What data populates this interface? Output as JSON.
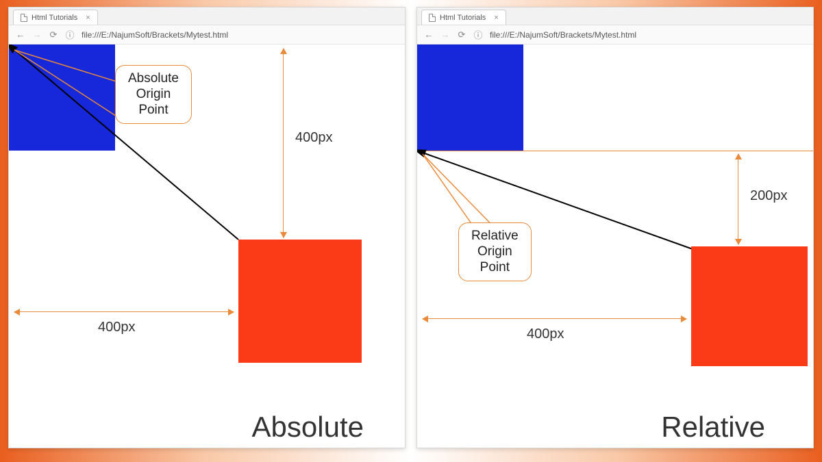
{
  "browser": {
    "tab_title": "Html Tutorials",
    "url": "file:///E:/NajumSoft/Brackets/Mytest.html"
  },
  "left_panel": {
    "callout": "Absolute\nOrigin\nPoint",
    "vertical_dim_label": "400px",
    "horizontal_dim_label": "400px",
    "caption": "Absolute"
  },
  "right_panel": {
    "callout": "Relative\nOrigin\nPoint",
    "vertical_dim_label": "200px",
    "horizontal_dim_label": "400px",
    "caption": "Relative"
  },
  "colors": {
    "blue_box": "#1727da",
    "red_box": "#fb3a18",
    "accent": "#e98a3a"
  }
}
